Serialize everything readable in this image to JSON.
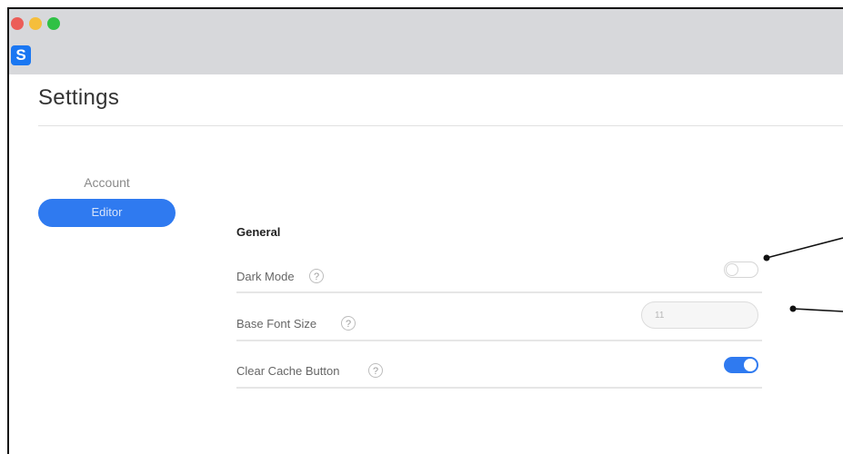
{
  "window": {
    "controls": [
      {
        "name": "close",
        "color": "#ec5d58"
      },
      {
        "name": "minimize",
        "color": "#f5be3c"
      },
      {
        "name": "zoom",
        "color": "#2fc145"
      }
    ],
    "app_logo_letter": "S",
    "app_logo_color": "#1a77f2"
  },
  "page": {
    "title": "Settings"
  },
  "sidebar": {
    "items": [
      {
        "label": "Account",
        "selected": false
      },
      {
        "label": "Editor",
        "selected": true
      }
    ]
  },
  "general": {
    "heading": "General",
    "rows": [
      {
        "label": "Dark Mode",
        "help_icon": "?",
        "control": "toggle",
        "state": "off"
      },
      {
        "label": "Base Font Size",
        "help_icon": "?",
        "control": "input",
        "value": "11"
      },
      {
        "label": "Clear Cache Button",
        "help_icon": "?",
        "control": "toggle",
        "state": "on"
      }
    ]
  },
  "accent_color": "#2f7af0"
}
